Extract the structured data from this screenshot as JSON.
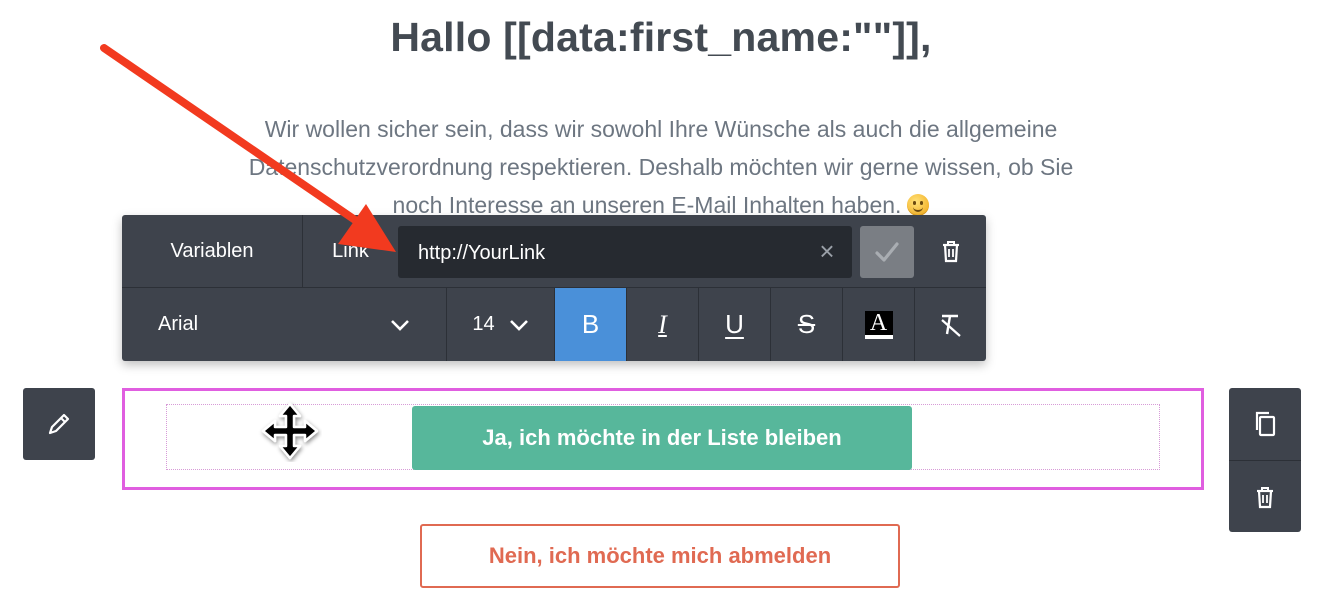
{
  "email": {
    "heading": "Hallo [[data:first_name:\"\"]],",
    "body_line1": "Wir wollen sicher sein, dass wir sowohl Ihre Wünsche als auch die allgemeine",
    "body_line2": "Datenschutzverordnung respektieren. Deshalb möchten wir gerne wissen, ob Sie",
    "body_line3": "noch Interesse an unseren E-Mail Inhalten haben.",
    "primary_button": "Ja, ich möchte in der Liste bleiben",
    "secondary_button": "Nein, ich möchte mich abmelden"
  },
  "toolbar": {
    "variables_label": "Variablen",
    "link_label": "Link",
    "link_value": "http://YourLink",
    "font_family": "Arial",
    "font_size": "14",
    "bold_label": "B",
    "italic_label": "I",
    "underline_label": "U",
    "strike_label": "S",
    "color_label": "A"
  },
  "colors": {
    "toolbar_bg": "#3e434c",
    "active_format": "#4a90d9",
    "primary_button": "#57b79b",
    "secondary_button": "#e06a52",
    "selection_border": "#e05ee0",
    "annotation_arrow": "#f23a1f"
  },
  "icons": {
    "clear": "close-icon",
    "confirm": "checkmark-icon",
    "delete": "trash-icon",
    "dropdown": "chevron-down-icon",
    "edit": "pencil-icon",
    "duplicate": "copy-icon",
    "move": "move-icon",
    "clear_format": "clear-format-icon"
  }
}
